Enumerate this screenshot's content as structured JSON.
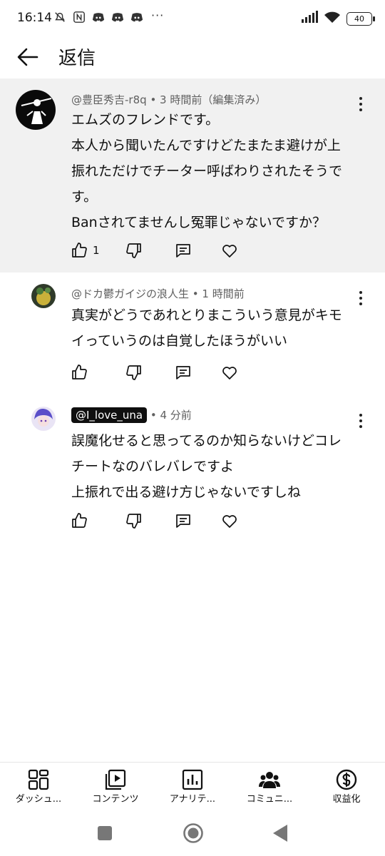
{
  "status_bar": {
    "time": "16:14",
    "overflow": "···",
    "battery": "40",
    "icons": [
      "mute-icon",
      "nfc-icon",
      "discord-icon",
      "discord-icon",
      "discord-icon",
      "signal-icon",
      "wifi-icon",
      "battery-icon"
    ]
  },
  "header": {
    "title": "返信",
    "back_icon": "arrow-left-icon"
  },
  "comments": [
    {
      "author": "@豊臣秀吉-r8q",
      "meta": "• 3 時間前（編集済み）",
      "lines": [
        "エムズのフレンドです。",
        "本人から聞いたんですけどたまたま避けが上",
        "振れただけでチーター呼ばわりされたそうで",
        "す。",
        "Banされてませんし冤罪じゃないですか？"
      ],
      "likes": "1"
    },
    {
      "author": "@ドカ鬱ガイジの浪人生",
      "meta": "• 1 時間前",
      "lines": [
        "真実がどうであれとりまこういう意見がキモ",
        "イっていうのは自覚したほうがいい"
      ]
    },
    {
      "author": "@I_love_una",
      "meta": "• 4 分前",
      "lines": [
        "誤魔化せると思ってるのか知らないけどコレ",
        "チートなのバレバレですよ",
        "上振れで出る避け方じゃないですしね"
      ]
    }
  ],
  "bottom_nav": [
    {
      "label": "ダッシュ...",
      "icon": "dashboard-icon"
    },
    {
      "label": "コンテンツ",
      "icon": "content-icon"
    },
    {
      "label": "アナリテ...",
      "icon": "analytics-icon"
    },
    {
      "label": "コミュニ...",
      "icon": "community-icon"
    },
    {
      "label": "収益化",
      "icon": "monetization-icon"
    }
  ],
  "system_nav": [
    "recents-square-icon",
    "home-circle-icon",
    "back-triangle-icon"
  ]
}
